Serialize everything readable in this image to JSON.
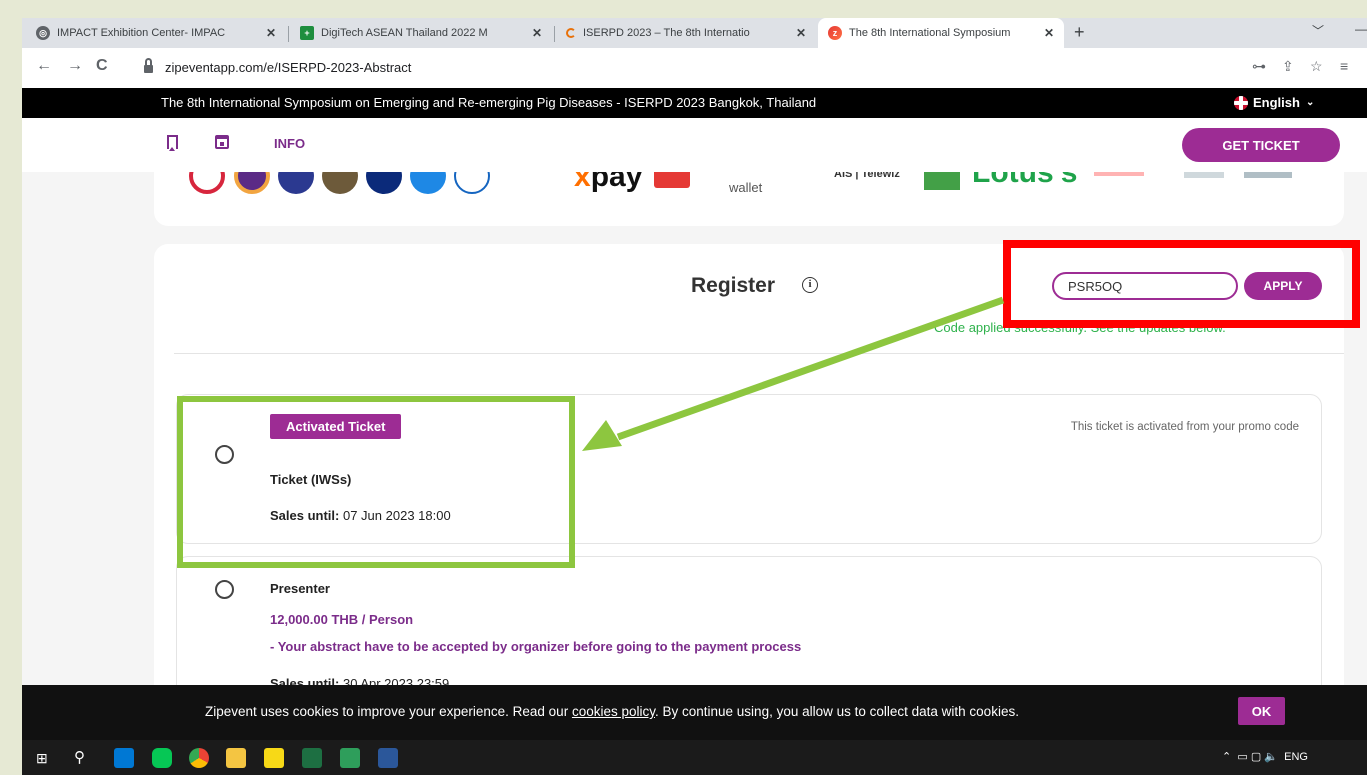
{
  "browser": {
    "tabs": [
      {
        "title": "IMPACT Exhibition Center- IMPAC",
        "favicon": "globe-icon"
      },
      {
        "title": "DigiTech ASEAN Thailand 2022 M",
        "favicon": "plus-square-icon"
      },
      {
        "title": "ISERPD 2023 – The 8th Internatio",
        "favicon": "loading-icon"
      },
      {
        "title": "The 8th International Symposium",
        "favicon": "zipevent-icon"
      }
    ],
    "new_tab_label": "+",
    "url": "zipeventapp.com/e/ISERPD-2023-Abstract"
  },
  "site": {
    "event_title": "The 8th International Symposium on Emerging and Re-emerging Pig Diseases - ISERPD 2023 Bangkok, Thailand",
    "language": "English",
    "nav_info": "INFO",
    "get_ticket": "GET TICKET",
    "sponsors": {
      "pay_text": "pay",
      "wallet_text": "wallet",
      "ais_text": "AIS | Telewiz",
      "lotus_text": "Lotus's"
    }
  },
  "register": {
    "title": "Register",
    "promo_code": "PSR5OQ",
    "apply_label": "APPLY",
    "code_message": "Code applied successfully. See the updates below."
  },
  "tickets": [
    {
      "badge": "Activated Ticket",
      "note": "This ticket is activated from your promo code",
      "name": "Ticket (IWSs)",
      "sales_label": "Sales until:",
      "sales_until": "07 Jun 2023 18:00"
    },
    {
      "name": "Presenter",
      "price": "12,000.00 THB / Person",
      "description": "- Your abstract have to be accepted by organizer before going to the payment process",
      "sales_label": "Sales until:",
      "sales_until": "30 Apr 2023 23:59"
    }
  ],
  "cookie": {
    "text_before": "Zipevent uses cookies to improve your experience. Read our ",
    "link": "cookies policy",
    "text_after": ". By continue using, you allow us to collect data with cookies.",
    "ok": "OK"
  },
  "taskbar": {
    "tray_lang": "ENG"
  },
  "colors": {
    "brand_purple": "#9d2c94",
    "success_green": "#2fb24c",
    "annotation_red": "#ff0000",
    "annotation_green": "#8dc63f"
  }
}
